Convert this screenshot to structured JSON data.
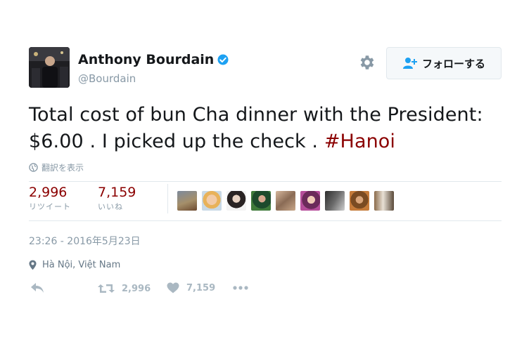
{
  "user": {
    "name": "Anthony Bourdain",
    "handle": "@Bourdain"
  },
  "follow_button": {
    "label": "フォローする"
  },
  "tweet": {
    "text": "Total cost of bun Cha dinner with the President: $6.00 . I picked up the check . ",
    "hashtag": "#Hanoi"
  },
  "translate_label": "翻訳を表示",
  "stats": {
    "retweets": {
      "count": "2,996",
      "label": "リツイート"
    },
    "likes": {
      "count": "7,159",
      "label": "いいね"
    }
  },
  "timestamp": "23:26 - 2016年5月23日",
  "location": "Hà Nội, Việt Nam",
  "actions": {
    "retweet_count": "2,996",
    "like_count": "7,159"
  },
  "colors": {
    "accent": "#8b0000",
    "muted": "#8899a6",
    "verified": "#1da1f2"
  }
}
